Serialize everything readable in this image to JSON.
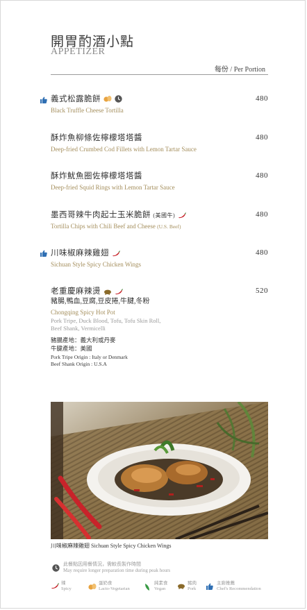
{
  "header": {
    "title_zh": "開胃酌酒小點",
    "title_en": "APPETIZER",
    "portion_label": "每份 / Per Portion"
  },
  "items": [
    {
      "name_zh": "義式松露脆餅",
      "name_en": "Black Truffle Cheese Tortilla",
      "price": "480",
      "icons": [
        "chef-recommendation",
        "lacto-vegetarian",
        "clock"
      ]
    },
    {
      "name_zh": "酥炸魚柳條佐檸檬塔塔醬",
      "name_en": "Deep-fried Crumbed Cod Fillets with Lemon Tartar Sauce",
      "price": "480"
    },
    {
      "name_zh": "酥炸魷魚圈佐檸檬塔塔醬",
      "name_en": "Deep-fried Squid Rings with Lemon Tartar Sauce",
      "price": "480"
    },
    {
      "name_zh": "墨西哥辣牛肉起士玉米脆餅",
      "name_zh_note": "(美國牛)",
      "name_en": "Tortilla Chips with Chili Beef and Cheese",
      "name_en_note": "(U.S. Beef)",
      "price": "480",
      "icons": [
        "spicy"
      ]
    },
    {
      "name_zh": "川味椒麻辣雞翅",
      "name_en": "Sichuan Style Spicy Chicken Wings",
      "price": "480",
      "icons": [
        "chef-recommendation",
        "spicy"
      ]
    },
    {
      "name_zh": "老重慶麻辣燙",
      "sub_zh": "豬腸,鴨血,豆腐,豆皮捲,牛腱,冬粉",
      "name_en": "Chongqing Spicy Hot Pot",
      "sub_en_1": "Pork Tripe, Duck Blood, Tofu, Tofu Skin Roll,",
      "sub_en_2": "Beef Shank, Vermicelli",
      "origin_zh_1": "豬腸產地：義大利或丹麥",
      "origin_zh_2": "牛腱產地：美國",
      "origin_en_1": "Pork Tripe Origin : Italy or Denmark",
      "origin_en_2": "Beef Shank Origin : U.S.A",
      "price": "520",
      "icons": [
        "pork",
        "spicy"
      ]
    }
  ],
  "photo": {
    "caption": "川味椒麻辣雞翅 Sichuan Style Spicy Chicken Wings"
  },
  "note": {
    "zh": "此餐點因用餐情況，需較長製作時間",
    "en": "May require longer preparation time during peak hours"
  },
  "legend": [
    {
      "icon": "spicy",
      "zh": "辣",
      "en": "Spicy"
    },
    {
      "icon": "lacto-vegetarian",
      "zh": "蛋奶食",
      "en": "Lacto-Vegetarian"
    },
    {
      "icon": "vegan",
      "zh": "純素食",
      "en": "Vegan"
    },
    {
      "icon": "pork",
      "zh": "豬肉",
      "en": "Pork"
    },
    {
      "icon": "chef-recommendation",
      "zh": "主廚推薦",
      "en": "Chef's Recommendation"
    }
  ],
  "colors": {
    "accent_gold": "#a48e5c",
    "spicy_red": "#c8232a",
    "thumb_blue": "#2f6fb3",
    "vegetarian_orange": "#e8a340",
    "vegan_green": "#3a9a45",
    "pork_brown": "#8a6a2a"
  }
}
